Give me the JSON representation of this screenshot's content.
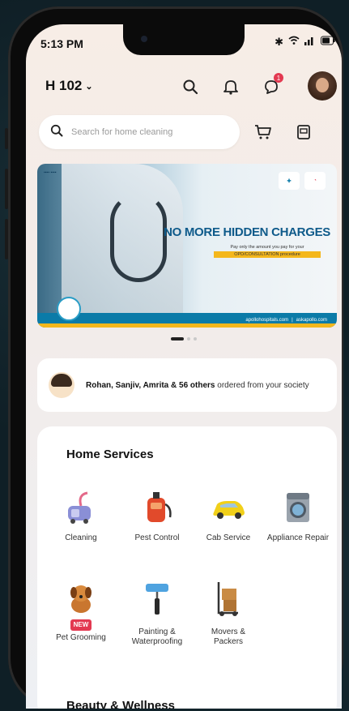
{
  "status": {
    "time": "5:13 PM"
  },
  "header": {
    "flat": "H 102",
    "notification_count": "1"
  },
  "search": {
    "placeholder": "Search for home cleaning"
  },
  "banner": {
    "headline": "NO MORE HIDDEN CHARGES",
    "subtext": "Pay only the amount you pay for your",
    "highlight": "OPD/CONSULTATION procedure",
    "footer_left": "apollohospitals.com",
    "footer_right": "askapollo.com",
    "slides": 3,
    "active_slide": 1
  },
  "social_proof": {
    "names": "Rohan, Sanjiv, Amrita & 56 others",
    "rest": " ordered from your society"
  },
  "home_services": {
    "title": "Home Services",
    "items": [
      {
        "label": "Cleaning",
        "icon": "vacuum-icon"
      },
      {
        "label": "Pest Control",
        "icon": "pest-sprayer-icon"
      },
      {
        "label": "Cab Service",
        "icon": "taxi-icon"
      },
      {
        "label": "Appliance Repair",
        "icon": "washing-machine-icon"
      },
      {
        "label": "Pet Grooming",
        "icon": "dog-icon",
        "badge": "NEW"
      },
      {
        "label": "Painting & Waterproofing",
        "icon": "paint-roller-icon"
      },
      {
        "label": "Movers & Packers",
        "icon": "trolley-icon"
      }
    ]
  },
  "next_section": {
    "title": "Beauty & Wellness"
  },
  "colors": {
    "badge": "#e33951",
    "brand_blue": "#0b7ba8",
    "highlight": "#f4b71c"
  }
}
